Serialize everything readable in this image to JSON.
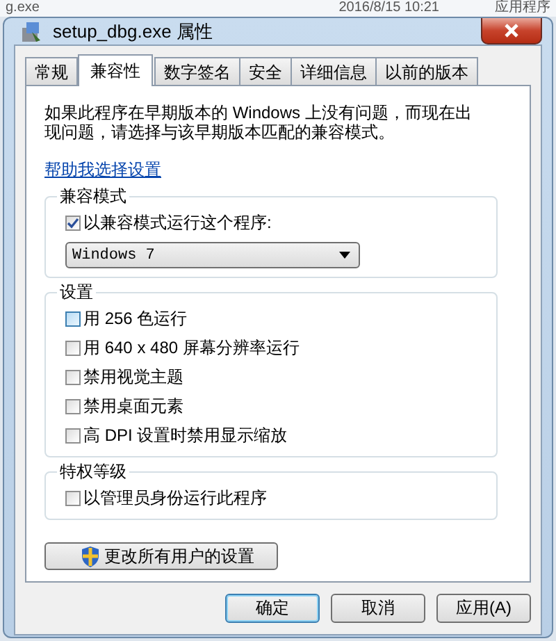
{
  "background_row": {
    "name": "g.exe",
    "date": "2016/8/15 10:21",
    "type": "应用程序"
  },
  "window": {
    "title": "setup_dbg.exe 属性"
  },
  "tabs": [
    {
      "label": "常规",
      "selected": false
    },
    {
      "label": "兼容性",
      "selected": true
    },
    {
      "label": "数字签名",
      "selected": false
    },
    {
      "label": "安全",
      "selected": false
    },
    {
      "label": "详细信息",
      "selected": false
    },
    {
      "label": "以前的版本",
      "selected": false
    }
  ],
  "description": "如果此程序在早期版本的 Windows 上没有问题，而现在出现问题，请选择与该早期版本匹配的兼容模式。",
  "help_link": "帮助我选择设置",
  "compat_mode": {
    "title": "兼容模式",
    "checkbox": {
      "label": "以兼容模式运行这个程序:",
      "checked": true
    },
    "dropdown": {
      "value": "Windows 7"
    }
  },
  "settings": {
    "title": "设置",
    "options": [
      {
        "label": "用 256 色运行",
        "checked": false,
        "hovered": true
      },
      {
        "label": "用 640 x 480 屏幕分辨率运行",
        "checked": false,
        "hovered": false
      },
      {
        "label": "禁用视觉主题",
        "checked": false,
        "hovered": false
      },
      {
        "label": "禁用桌面元素",
        "checked": false,
        "hovered": false
      },
      {
        "label": "高 DPI 设置时禁用显示缩放",
        "checked": false,
        "hovered": false
      }
    ]
  },
  "privilege": {
    "title": "特权等级",
    "options": [
      {
        "label": "以管理员身份运行此程序",
        "checked": false,
        "hovered": false
      }
    ]
  },
  "change_all_button": {
    "label": "更改所有用户的设置"
  },
  "buttons": [
    {
      "label": "确定",
      "focused": true
    },
    {
      "label": "取消",
      "focused": false
    },
    {
      "label": "应用(A)",
      "focused": false
    }
  ]
}
